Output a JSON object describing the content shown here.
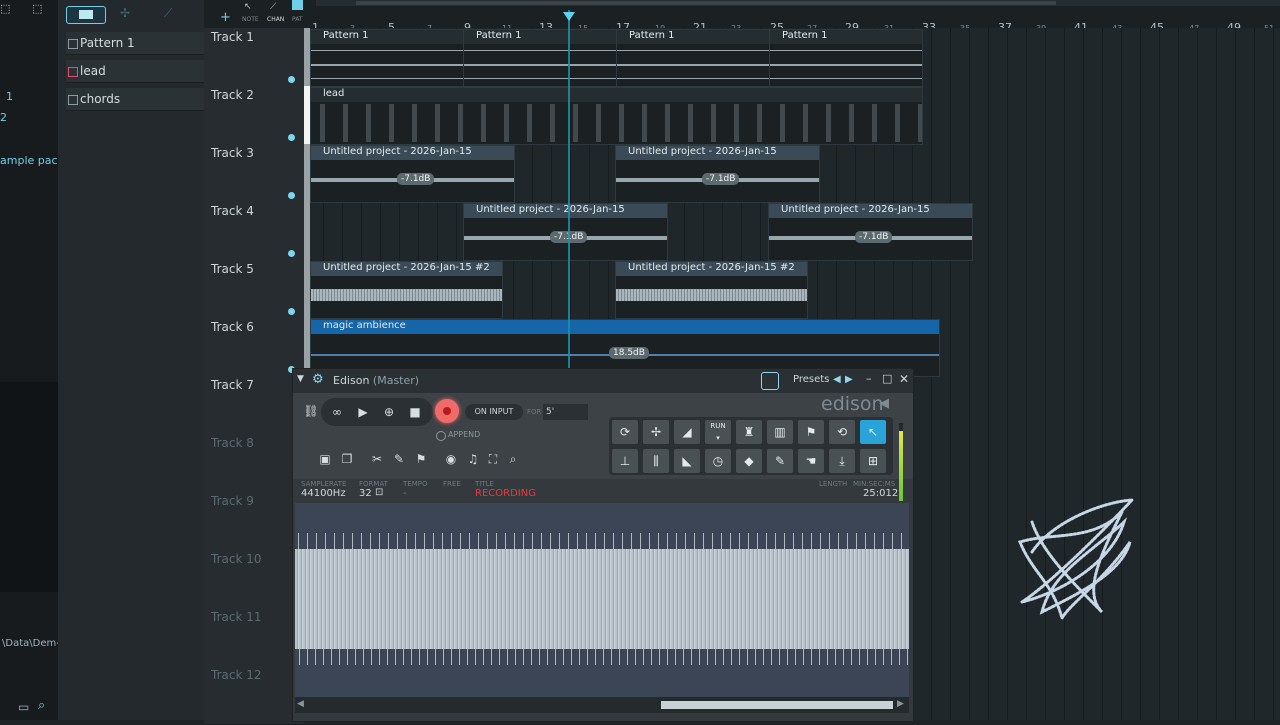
{
  "browser": {
    "line1": "1",
    "line2": "2",
    "sample_pack": "ample pack",
    "path": "\\Data\\Dem-"
  },
  "toolbar": {
    "note": "NOTE",
    "chan": "CHAN",
    "pat": "PAT"
  },
  "patterns": [
    {
      "label": "Pattern 1"
    },
    {
      "label": "lead"
    },
    {
      "label": "chords"
    }
  ],
  "ruler": {
    "major": [
      "1",
      "5",
      "9",
      "13",
      "17",
      "21",
      "25",
      "29",
      "33",
      "37",
      "41",
      "45",
      "49"
    ],
    "minor": [
      "3",
      "7",
      "11",
      "15",
      "19",
      "23",
      "27",
      "31",
      "35",
      "39",
      "43",
      "47",
      "51"
    ]
  },
  "tracks": [
    {
      "label": "Track 1"
    },
    {
      "label": "Track 2"
    },
    {
      "label": "Track 3"
    },
    {
      "label": "Track 4"
    },
    {
      "label": "Track 5"
    },
    {
      "label": "Track 6"
    },
    {
      "label": "Track 7"
    },
    {
      "label": "Track 8"
    },
    {
      "label": "Track 9"
    },
    {
      "label": "Track 10"
    },
    {
      "label": "Track 11"
    },
    {
      "label": "Track 12"
    }
  ],
  "clips": {
    "pattern1": "Pattern 1",
    "lead": "lead",
    "audio": "Untitled project - 2026-Jan-15",
    "audio2": "Untitled project - 2026-Jan-15 #2",
    "ambience": "magic ambience",
    "gain": "-7.1dB",
    "ambience_gain": "18.5dB"
  },
  "edison": {
    "title": "Edison",
    "title_sub": "(Master)",
    "presets": "Presets",
    "logo": "edison",
    "on_input": "ON INPUT",
    "for_label": "FOR",
    "for_value": "5'",
    "append": "APPEND",
    "meta": {
      "samplerate_label": "SAMPLERATE",
      "samplerate": "44100Hz",
      "format_label": "FORMAT",
      "format": "32",
      "tempo_label": "TEMPO",
      "tempo": "-",
      "free_label": "FREE",
      "title_label": "TITLE",
      "title": "RECORDING",
      "length_label": "LENGTH",
      "minsec_label": "MIN:SEC:MS",
      "length": "25:012"
    }
  },
  "colors": {
    "accent": "#2aa3d9",
    "recording": "#e83b3b",
    "clip_header": "#3a4a56",
    "ambience_header": "#1665a8"
  }
}
